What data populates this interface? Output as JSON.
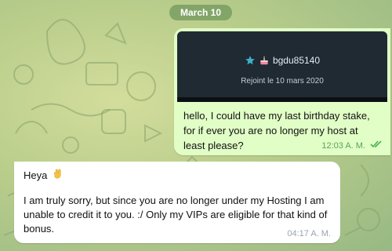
{
  "date_separator": "March 10",
  "outgoing_message": {
    "preview": {
      "username": "bgdu85140",
      "joined_text": "Rejoint le 10 mars 2020",
      "icons": [
        "star-icon",
        "birthday-cake-icon"
      ]
    },
    "text": "hello, I could have my last birthday stake, for if ever you are no longer my host at least please?",
    "time": "12:03 A. M.",
    "status_icon": "double-check-icon",
    "status_color": "#4fb34f"
  },
  "incoming_message": {
    "greeting": "Heya",
    "greeting_icon": "waving-hand-icon",
    "text": "I am truly sorry, but since you are no longer under my Hosting I am unable to credit it to you. :/ Only my VIPs are eligible for that kind of bonus.",
    "time": "04:17 A. M."
  },
  "colors": {
    "outgoing_bubble": "#e1fec6",
    "incoming_bubble": "#ffffff",
    "preview_background": "#1f2a33",
    "date_pill": "#6e965a"
  }
}
